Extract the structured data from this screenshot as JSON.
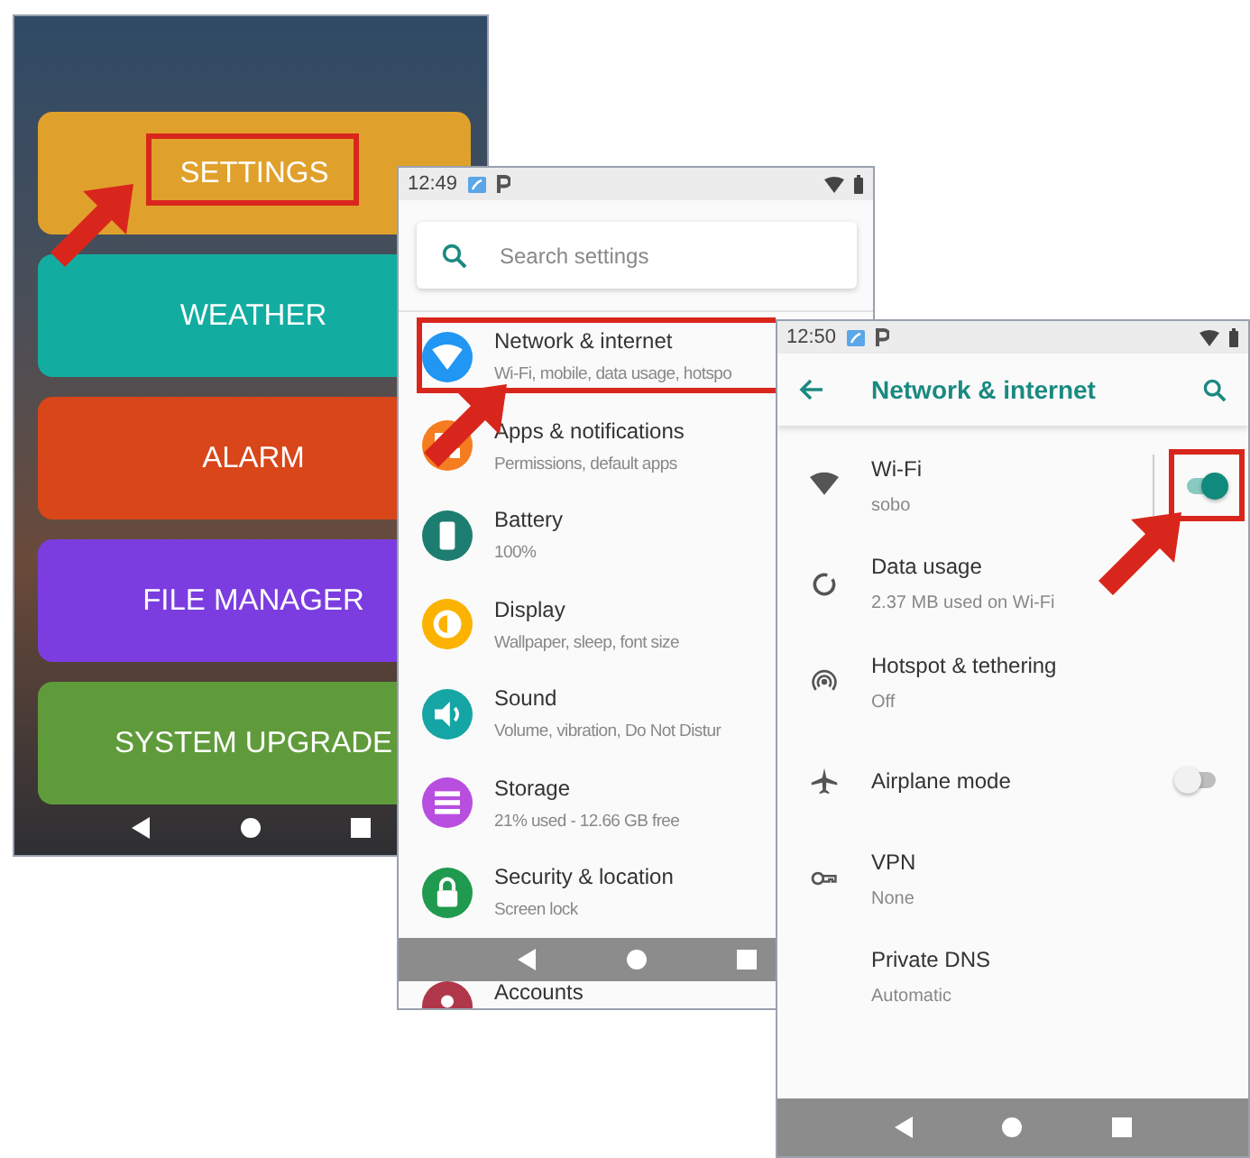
{
  "launcher": {
    "buttons": [
      {
        "label": "SETTINGS",
        "color": "#e0a12c",
        "highlighted": true
      },
      {
        "label": "WEATHER",
        "color": "#12ada0",
        "highlighted": false
      },
      {
        "label": "ALARM",
        "color": "#d8461a",
        "highlighted": false
      },
      {
        "label": "FILE MANAGER",
        "color": "#7b3de0",
        "highlighted": false
      },
      {
        "label": "SYSTEM UPGRADE",
        "color": "#609b3b",
        "highlighted": false
      }
    ]
  },
  "settings": {
    "status_bar": {
      "time": "12:49"
    },
    "search": {
      "placeholder": "Search settings"
    },
    "items": [
      {
        "title": "Network & internet",
        "subtitle": "Wi-Fi, mobile, data usage, hotspo",
        "color": "#2196f3",
        "highlighted": true
      },
      {
        "title": "Apps & notifications",
        "subtitle": "Permissions, default apps",
        "color": "#f57c1f",
        "highlighted": false
      },
      {
        "title": "Battery",
        "subtitle": "100%",
        "color": "#1e7d71",
        "highlighted": false
      },
      {
        "title": "Display",
        "subtitle": "Wallpaper, sleep, font size",
        "color": "#fbb200",
        "highlighted": false
      },
      {
        "title": "Sound",
        "subtitle": "Volume, vibration, Do Not Distur",
        "color": "#16a5a5",
        "highlighted": false
      },
      {
        "title": "Storage",
        "subtitle": "21% used - 12.66 GB free",
        "color": "#b84ee0",
        "highlighted": false
      },
      {
        "title": "Security & location",
        "subtitle": "Screen lock",
        "color": "#1f9a4e",
        "highlighted": false
      },
      {
        "title": "Accounts",
        "color": "#b0374a",
        "highlighted": false
      }
    ]
  },
  "network": {
    "status_bar": {
      "time": "12:50"
    },
    "title": "Network & internet",
    "items": [
      {
        "kind": "toggle",
        "title": "Wi-Fi",
        "subtitle": "sobo",
        "on": true,
        "highlighted": true
      },
      {
        "kind": "plain",
        "title": "Data usage",
        "subtitle": "2.37 MB used on Wi-Fi"
      },
      {
        "kind": "plain",
        "title": "Hotspot & tethering",
        "subtitle": "Off"
      },
      {
        "kind": "toggle",
        "title": "Airplane mode",
        "on": false,
        "highlighted": false
      },
      {
        "kind": "plain",
        "title": "VPN",
        "subtitle": "None"
      },
      {
        "kind": "plain",
        "title": "Private DNS",
        "subtitle": "Automatic"
      }
    ]
  }
}
